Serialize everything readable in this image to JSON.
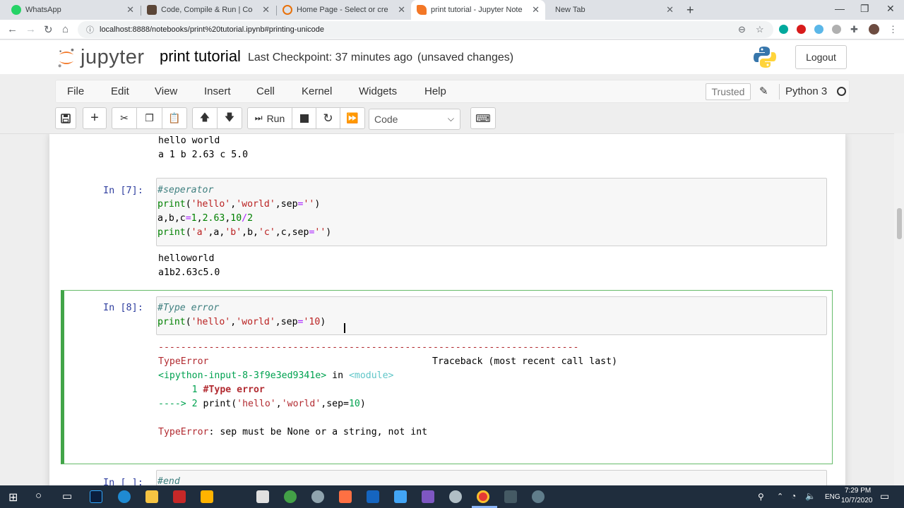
{
  "browser": {
    "tabs": [
      {
        "title": "WhatsApp",
        "color": "#25d366"
      },
      {
        "title": "Code, Compile & Run | CodeChef",
        "color": "#5b4638"
      },
      {
        "title": "Home Page - Select or create a n",
        "color": "#e8710a"
      },
      {
        "title": "print tutorial - Jupyter Notebook",
        "color": "#f37726"
      },
      {
        "title": "New Tab",
        "color": "#ffffff"
      }
    ],
    "url": "localhost:8888/notebooks/print%20tutorial.ipynb#printing-unicode"
  },
  "header": {
    "logo_text": "jupyter",
    "title": "print tutorial",
    "checkpoint": "Last Checkpoint: 37 minutes ago",
    "status": "(unsaved changes)",
    "logout": "Logout"
  },
  "menubar": {
    "items": [
      "File",
      "Edit",
      "View",
      "Insert",
      "Cell",
      "Kernel",
      "Widgets",
      "Help"
    ],
    "trusted": "Trusted",
    "kernel": "Python 3"
  },
  "toolbar": {
    "run_label": "Run",
    "cell_type": "Code"
  },
  "cells": {
    "prev_output": [
      "hello world",
      "a 1 b 2.63 c 5.0"
    ],
    "cell7": {
      "prompt": "In [7]:",
      "code": [
        "#seperator",
        "print('hello','world',sep='')",
        "a,b,c=1,2.63,10/2",
        "print('a',a,'b',b,'c',c,sep='')"
      ],
      "output": [
        "helloworld",
        "a1b2.63c5.0"
      ]
    },
    "cell8": {
      "prompt": "In [8]:",
      "code": [
        "#Type error",
        "print('hello','world',sep='10)"
      ],
      "dashes": "---------------------------------------------------------------------------",
      "error_name": "TypeError",
      "traceback_label": "Traceback (most recent call last)",
      "ipython_input": "<ipython-input-8-3f9e3ed9341e>",
      "in_word": " in ",
      "module": "<module>",
      "line1_num": "      1 ",
      "line1_code": "#Type error",
      "arrow": "----> 2 ",
      "line2_code": "print('hello','world',sep=10)",
      "error_label": "TypeError",
      "error_msg": ": sep must be None or a string, not int"
    },
    "cell9": {
      "prompt": "In [ ]:",
      "code": "#end"
    }
  },
  "taskbar": {
    "time": "7:29 PM",
    "date": "10/7/2020",
    "lang": "ENG"
  }
}
